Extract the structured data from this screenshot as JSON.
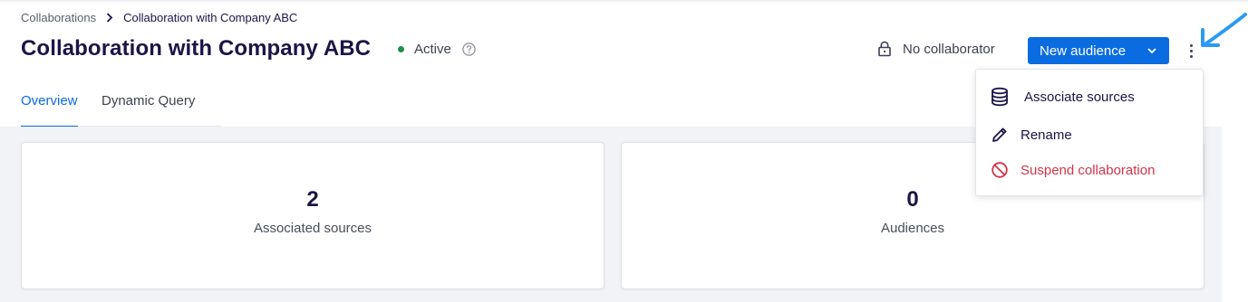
{
  "breadcrumb": {
    "parent": "Collaborations",
    "current": "Collaboration with Company ABC"
  },
  "header": {
    "title": "Collaboration with Company ABC",
    "status": "Active",
    "status_color": "#1f8f4f",
    "lock_text": "No collaborator",
    "new_audience_label": "New audience"
  },
  "tabs": [
    {
      "label": "Overview",
      "active": true
    },
    {
      "label": "Dynamic Query",
      "active": false
    }
  ],
  "cards": [
    {
      "value": "2",
      "label": "Associated sources"
    },
    {
      "value": "0",
      "label": "Audiences"
    }
  ],
  "menu": {
    "items": [
      {
        "label": "Associate sources",
        "icon": "database-icon"
      },
      {
        "label": "Rename",
        "icon": "pencil-icon"
      },
      {
        "label": "Suspend collaboration",
        "icon": "ban-icon",
        "color": "#d2344a"
      }
    ]
  },
  "colors": {
    "primary": "#0a6ce0",
    "danger": "#d2344a",
    "text": "#1b1547",
    "annotation_arrow": "#2b9af3"
  }
}
